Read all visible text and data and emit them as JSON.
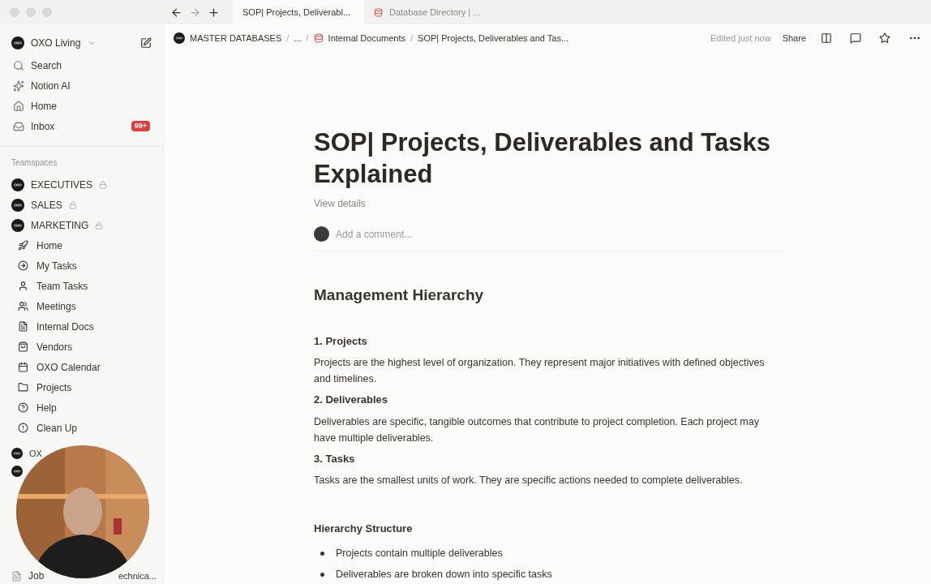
{
  "browser": {
    "tabs": [
      {
        "label": "SOP| Projects, Deliverabl...",
        "selected": true,
        "kind": "page"
      },
      {
        "label": "Database Directory | ...",
        "selected": false,
        "kind": "database"
      }
    ]
  },
  "workspace": {
    "name": "OXO Living"
  },
  "sidebar": {
    "nav": [
      {
        "label": "Search",
        "kind": "search"
      },
      {
        "label": "Notion AI",
        "kind": "ai"
      },
      {
        "label": "Home",
        "kind": "home"
      },
      {
        "label": "Inbox",
        "kind": "inbox",
        "badge": "99+"
      }
    ],
    "teamspaces_label": "Teamspaces",
    "teamspaces": [
      {
        "label": "EXECUTIVES",
        "locked": true
      },
      {
        "label": "SALES",
        "locked": true
      },
      {
        "label": "MARKETING",
        "locked": true,
        "children": [
          {
            "label": "Home",
            "kind": "rocket"
          },
          {
            "label": "My Tasks",
            "kind": "arrow"
          },
          {
            "label": "Team Tasks",
            "kind": "person"
          },
          {
            "label": "Meetings",
            "kind": "people"
          },
          {
            "label": "Internal Docs",
            "kind": "doc"
          },
          {
            "label": "Vendors",
            "kind": "bag"
          },
          {
            "label": "OXO Calendar",
            "kind": "calendar"
          },
          {
            "label": "Projects",
            "kind": "folder"
          },
          {
            "label": "Help",
            "kind": "help"
          },
          {
            "label": "Clean Up",
            "kind": "alert"
          }
        ]
      }
    ],
    "partial_items": [
      {
        "label": "OX",
        "kind": "team"
      },
      {
        "kind": "team"
      }
    ],
    "last_item": {
      "label_start": "Job",
      "label_end": "echnica..."
    }
  },
  "breadcrumb": [
    {
      "label": "MASTER DATABASES",
      "kind": "team"
    },
    {
      "label": "...",
      "kind": "plain",
      "separator": "/"
    },
    {
      "label": "Internal Documents",
      "kind": "database",
      "separator": "/"
    },
    {
      "label": "SOP| Projects, Deliverables and Tas...",
      "kind": "plain",
      "separator": "/"
    }
  ],
  "topbar": {
    "status": "Edited just now",
    "share": "Share"
  },
  "page": {
    "title": "SOP| Projects, Deliverables and Tasks Explained",
    "view_details": "View details",
    "comment_placeholder": "Add a comment...",
    "blocks": [
      {
        "kind": "h2",
        "text": "Management Hierarchy"
      },
      {
        "kind": "h4",
        "text": "1. Projects"
      },
      {
        "kind": "p",
        "text": "Projects are the highest level of organization. They represent major initiatives with defined objectives and timelines."
      },
      {
        "kind": "h4",
        "text": "2. Deliverables"
      },
      {
        "kind": "p",
        "text": "Deliverables are specific, tangible outcomes that contribute to project completion. Each project may have multiple deliverables."
      },
      {
        "kind": "h4",
        "text": "3. Tasks"
      },
      {
        "kind": "p",
        "text": "Tasks are the smallest units of work. They are specific actions needed to complete deliverables."
      },
      {
        "kind": "h3",
        "text": "Hierarchy Structure"
      },
      {
        "kind": "bullet",
        "text": "Projects contain multiple deliverables"
      },
      {
        "kind": "bullet",
        "text": "Deliverables are broken down into specific tasks"
      }
    ]
  }
}
